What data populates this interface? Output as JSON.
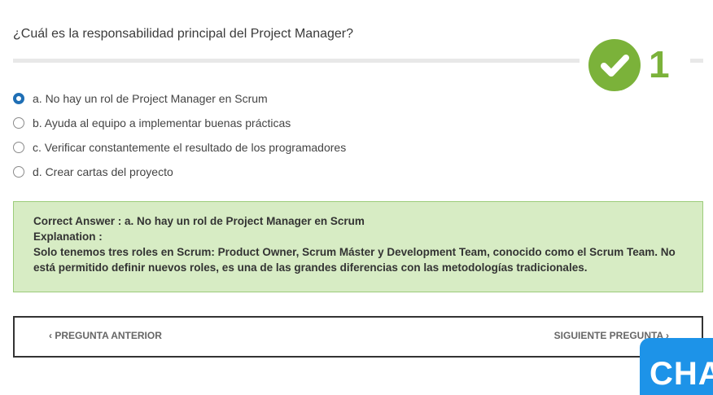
{
  "question": {
    "text": "¿Cuál es la responsabilidad principal del Project Manager?",
    "number": "1"
  },
  "options": [
    {
      "label": "a. No hay un rol de Project Manager en Scrum",
      "selected": true
    },
    {
      "label": "b. Ayuda al equipo a implementar buenas prácticas",
      "selected": false
    },
    {
      "label": "c. Verificar constantemente el resultado de los programadores",
      "selected": false
    },
    {
      "label": "d. Crear cartas del proyecto",
      "selected": false
    }
  ],
  "feedback": {
    "correct_answer": "Correct Answer : a. No hay un rol de Project Manager en Scrum",
    "explanation_label": "Explanation :",
    "explanation_text": "Solo tenemos tres roles en Scrum: Product Owner, Scrum Máster y Development Team, conocido como el Scrum Team. No está permitido definir nuevos roles, es una de las grandes diferencias con las metodologías tradicionales."
  },
  "nav": {
    "prev_label": "‹ PREGUNTA ANTERIOR",
    "next_label": "SIGUIENTE PREGUNTA ›"
  },
  "chat": {
    "label": "CHA"
  },
  "colors": {
    "success_green": "#7bb23a",
    "feedback_bg": "#d7ecc4",
    "radio_selected": "#1f6fb5",
    "chat_blue": "#1d93e8"
  },
  "icons": {
    "badge": "checkmark-icon"
  }
}
